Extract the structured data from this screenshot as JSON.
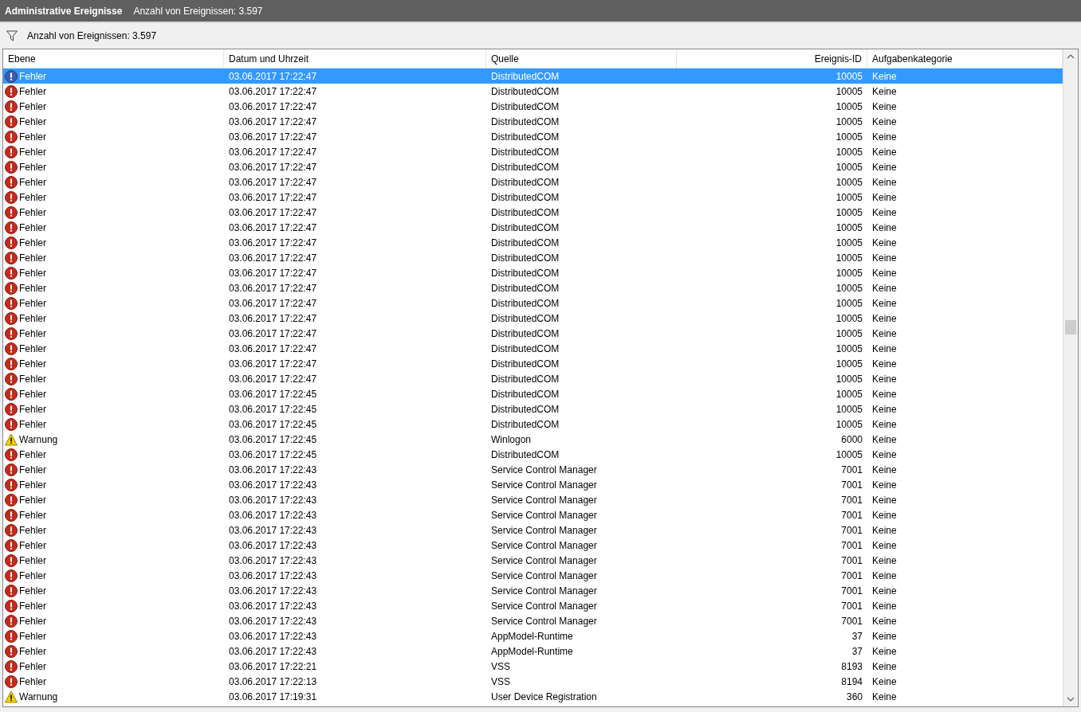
{
  "header": {
    "title": "Administrative Ereignisse",
    "subtitle": "Anzahl von Ereignissen: 3.597"
  },
  "filter_bar": {
    "text": "Anzahl von Ereignissen: 3.597"
  },
  "table": {
    "columns": [
      "Ebene",
      "Datum und Uhrzeit",
      "Quelle",
      "Ereignis-ID",
      "Aufgabenkategorie"
    ],
    "rows": [
      {
        "kind": "error",
        "level_text": "Fehler",
        "date": "03.06.2017 17:22:47",
        "source": "DistributedCOM",
        "event_id": "10005",
        "category": "Keine",
        "selected": true
      },
      {
        "kind": "error",
        "level_text": "Fehler",
        "date": "03.06.2017 17:22:47",
        "source": "DistributedCOM",
        "event_id": "10005",
        "category": "Keine",
        "selected": false
      },
      {
        "kind": "error",
        "level_text": "Fehler",
        "date": "03.06.2017 17:22:47",
        "source": "DistributedCOM",
        "event_id": "10005",
        "category": "Keine",
        "selected": false
      },
      {
        "kind": "error",
        "level_text": "Fehler",
        "date": "03.06.2017 17:22:47",
        "source": "DistributedCOM",
        "event_id": "10005",
        "category": "Keine",
        "selected": false
      },
      {
        "kind": "error",
        "level_text": "Fehler",
        "date": "03.06.2017 17:22:47",
        "source": "DistributedCOM",
        "event_id": "10005",
        "category": "Keine",
        "selected": false
      },
      {
        "kind": "error",
        "level_text": "Fehler",
        "date": "03.06.2017 17:22:47",
        "source": "DistributedCOM",
        "event_id": "10005",
        "category": "Keine",
        "selected": false
      },
      {
        "kind": "error",
        "level_text": "Fehler",
        "date": "03.06.2017 17:22:47",
        "source": "DistributedCOM",
        "event_id": "10005",
        "category": "Keine",
        "selected": false
      },
      {
        "kind": "error",
        "level_text": "Fehler",
        "date": "03.06.2017 17:22:47",
        "source": "DistributedCOM",
        "event_id": "10005",
        "category": "Keine",
        "selected": false
      },
      {
        "kind": "error",
        "level_text": "Fehler",
        "date": "03.06.2017 17:22:47",
        "source": "DistributedCOM",
        "event_id": "10005",
        "category": "Keine",
        "selected": false
      },
      {
        "kind": "error",
        "level_text": "Fehler",
        "date": "03.06.2017 17:22:47",
        "source": "DistributedCOM",
        "event_id": "10005",
        "category": "Keine",
        "selected": false
      },
      {
        "kind": "error",
        "level_text": "Fehler",
        "date": "03.06.2017 17:22:47",
        "source": "DistributedCOM",
        "event_id": "10005",
        "category": "Keine",
        "selected": false
      },
      {
        "kind": "error",
        "level_text": "Fehler",
        "date": "03.06.2017 17:22:47",
        "source": "DistributedCOM",
        "event_id": "10005",
        "category": "Keine",
        "selected": false
      },
      {
        "kind": "error",
        "level_text": "Fehler",
        "date": "03.06.2017 17:22:47",
        "source": "DistributedCOM",
        "event_id": "10005",
        "category": "Keine",
        "selected": false
      },
      {
        "kind": "error",
        "level_text": "Fehler",
        "date": "03.06.2017 17:22:47",
        "source": "DistributedCOM",
        "event_id": "10005",
        "category": "Keine",
        "selected": false
      },
      {
        "kind": "error",
        "level_text": "Fehler",
        "date": "03.06.2017 17:22:47",
        "source": "DistributedCOM",
        "event_id": "10005",
        "category": "Keine",
        "selected": false
      },
      {
        "kind": "error",
        "level_text": "Fehler",
        "date": "03.06.2017 17:22:47",
        "source": "DistributedCOM",
        "event_id": "10005",
        "category": "Keine",
        "selected": false
      },
      {
        "kind": "error",
        "level_text": "Fehler",
        "date": "03.06.2017 17:22:47",
        "source": "DistributedCOM",
        "event_id": "10005",
        "category": "Keine",
        "selected": false
      },
      {
        "kind": "error",
        "level_text": "Fehler",
        "date": "03.06.2017 17:22:47",
        "source": "DistributedCOM",
        "event_id": "10005",
        "category": "Keine",
        "selected": false
      },
      {
        "kind": "error",
        "level_text": "Fehler",
        "date": "03.06.2017 17:22:47",
        "source": "DistributedCOM",
        "event_id": "10005",
        "category": "Keine",
        "selected": false
      },
      {
        "kind": "error",
        "level_text": "Fehler",
        "date": "03.06.2017 17:22:47",
        "source": "DistributedCOM",
        "event_id": "10005",
        "category": "Keine",
        "selected": false
      },
      {
        "kind": "error",
        "level_text": "Fehler",
        "date": "03.06.2017 17:22:47",
        "source": "DistributedCOM",
        "event_id": "10005",
        "category": "Keine",
        "selected": false
      },
      {
        "kind": "error",
        "level_text": "Fehler",
        "date": "03.06.2017 17:22:45",
        "source": "DistributedCOM",
        "event_id": "10005",
        "category": "Keine",
        "selected": false
      },
      {
        "kind": "error",
        "level_text": "Fehler",
        "date": "03.06.2017 17:22:45",
        "source": "DistributedCOM",
        "event_id": "10005",
        "category": "Keine",
        "selected": false
      },
      {
        "kind": "error",
        "level_text": "Fehler",
        "date": "03.06.2017 17:22:45",
        "source": "DistributedCOM",
        "event_id": "10005",
        "category": "Keine",
        "selected": false
      },
      {
        "kind": "warning",
        "level_text": "Warnung",
        "date": "03.06.2017 17:22:45",
        "source": "Winlogon",
        "event_id": "6000",
        "category": "Keine",
        "selected": false
      },
      {
        "kind": "error",
        "level_text": "Fehler",
        "date": "03.06.2017 17:22:45",
        "source": "DistributedCOM",
        "event_id": "10005",
        "category": "Keine",
        "selected": false
      },
      {
        "kind": "error",
        "level_text": "Fehler",
        "date": "03.06.2017 17:22:43",
        "source": "Service Control Manager",
        "event_id": "7001",
        "category": "Keine",
        "selected": false
      },
      {
        "kind": "error",
        "level_text": "Fehler",
        "date": "03.06.2017 17:22:43",
        "source": "Service Control Manager",
        "event_id": "7001",
        "category": "Keine",
        "selected": false
      },
      {
        "kind": "error",
        "level_text": "Fehler",
        "date": "03.06.2017 17:22:43",
        "source": "Service Control Manager",
        "event_id": "7001",
        "category": "Keine",
        "selected": false
      },
      {
        "kind": "error",
        "level_text": "Fehler",
        "date": "03.06.2017 17:22:43",
        "source": "Service Control Manager",
        "event_id": "7001",
        "category": "Keine",
        "selected": false
      },
      {
        "kind": "error",
        "level_text": "Fehler",
        "date": "03.06.2017 17:22:43",
        "source": "Service Control Manager",
        "event_id": "7001",
        "category": "Keine",
        "selected": false
      },
      {
        "kind": "error",
        "level_text": "Fehler",
        "date": "03.06.2017 17:22:43",
        "source": "Service Control Manager",
        "event_id": "7001",
        "category": "Keine",
        "selected": false
      },
      {
        "kind": "error",
        "level_text": "Fehler",
        "date": "03.06.2017 17:22:43",
        "source": "Service Control Manager",
        "event_id": "7001",
        "category": "Keine",
        "selected": false
      },
      {
        "kind": "error",
        "level_text": "Fehler",
        "date": "03.06.2017 17:22:43",
        "source": "Service Control Manager",
        "event_id": "7001",
        "category": "Keine",
        "selected": false
      },
      {
        "kind": "error",
        "level_text": "Fehler",
        "date": "03.06.2017 17:22:43",
        "source": "Service Control Manager",
        "event_id": "7001",
        "category": "Keine",
        "selected": false
      },
      {
        "kind": "error",
        "level_text": "Fehler",
        "date": "03.06.2017 17:22:43",
        "source": "Service Control Manager",
        "event_id": "7001",
        "category": "Keine",
        "selected": false
      },
      {
        "kind": "error",
        "level_text": "Fehler",
        "date": "03.06.2017 17:22:43",
        "source": "Service Control Manager",
        "event_id": "7001",
        "category": "Keine",
        "selected": false
      },
      {
        "kind": "error",
        "level_text": "Fehler",
        "date": "03.06.2017 17:22:43",
        "source": "AppModel-Runtime",
        "event_id": "37",
        "category": "Keine",
        "selected": false
      },
      {
        "kind": "error",
        "level_text": "Fehler",
        "date": "03.06.2017 17:22:43",
        "source": "AppModel-Runtime",
        "event_id": "37",
        "category": "Keine",
        "selected": false
      },
      {
        "kind": "error",
        "level_text": "Fehler",
        "date": "03.06.2017 17:22:21",
        "source": "VSS",
        "event_id": "8193",
        "category": "Keine",
        "selected": false
      },
      {
        "kind": "error",
        "level_text": "Fehler",
        "date": "03.06.2017 17:22:13",
        "source": "VSS",
        "event_id": "8194",
        "category": "Keine",
        "selected": false
      },
      {
        "kind": "warning",
        "level_text": "Warnung",
        "date": "03.06.2017 17:19:31",
        "source": "User Device Registration",
        "event_id": "360",
        "category": "Keine",
        "selected": false
      }
    ]
  }
}
